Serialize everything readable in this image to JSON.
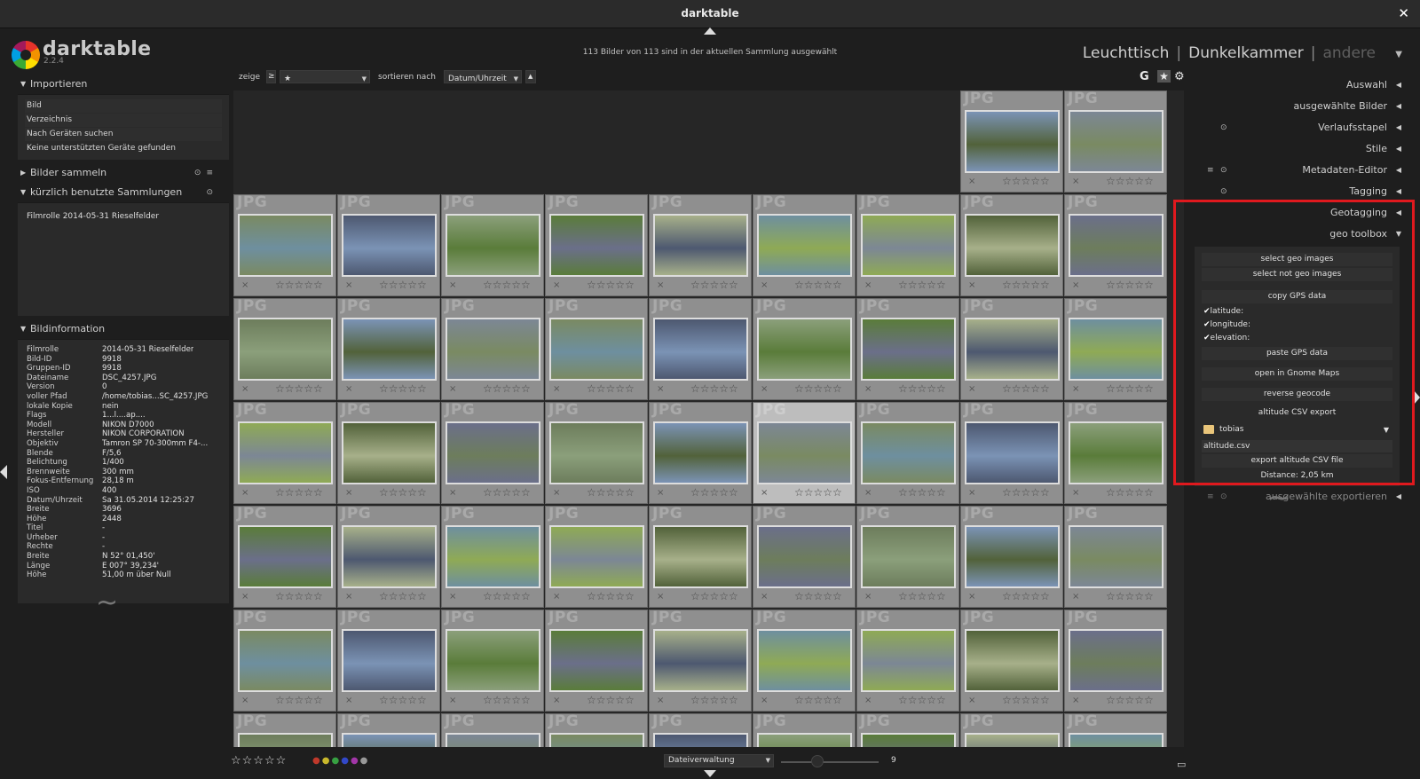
{
  "window": {
    "title": "darktable",
    "close_glyph": "✕"
  },
  "app": {
    "name": "darktable",
    "version": "2.2.4"
  },
  "status": "113 Bilder von 113 sind in der aktuellen Sammlung ausgewählt",
  "views": {
    "lighttable": "Leuchttisch",
    "darkroom": "Dunkelkammer",
    "other": "andere",
    "sep": "|"
  },
  "left": {
    "import": {
      "header": "Importieren",
      "buttons": [
        "Bild",
        "Verzeichnis",
        "Nach Geräten suchen"
      ],
      "note": "Keine unterstützten Geräte gefunden"
    },
    "collect": {
      "header": "Bilder sammeln"
    },
    "recent": {
      "header": "kürzlich benutzte Sammlungen",
      "items": [
        "Filmrolle 2014-05-31 Rieselfelder"
      ]
    },
    "info": {
      "header": "Bildinformation",
      "rows": [
        {
          "k": "Filmrolle",
          "v": "2014-05-31 Rieselfelder"
        },
        {
          "k": "Bild-ID",
          "v": "9918"
        },
        {
          "k": "Gruppen-ID",
          "v": "9918"
        },
        {
          "k": "Dateiname",
          "v": "DSC_4257.JPG"
        },
        {
          "k": "Version",
          "v": "0"
        },
        {
          "k": "voller Pfad",
          "v": "/home/tobias...SC_4257.JPG"
        },
        {
          "k": "lokale Kopie",
          "v": "nein"
        },
        {
          "k": "Flags",
          "v": "1...l....ap...."
        },
        {
          "k": "Modell",
          "v": "NIKON D7000"
        },
        {
          "k": "Hersteller",
          "v": "NIKON CORPORATION"
        },
        {
          "k": "Objektiv",
          "v": "Tamron SP 70-300mm F4-..."
        },
        {
          "k": "Blende",
          "v": "F/5,6"
        },
        {
          "k": "Belichtung",
          "v": "1/400"
        },
        {
          "k": "Brennweite",
          "v": "300 mm"
        },
        {
          "k": "Fokus-Entfernung",
          "v": "28,18 m"
        },
        {
          "k": "ISO",
          "v": "400"
        },
        {
          "k": "Datum/Uhrzeit",
          "v": "Sa 31.05.2014 12:25:27"
        },
        {
          "k": "Breite",
          "v": "3696"
        },
        {
          "k": "Höhe",
          "v": "2448"
        },
        {
          "k": "Titel",
          "v": "-"
        },
        {
          "k": "Urheber",
          "v": "-"
        },
        {
          "k": "Rechte",
          "v": "-"
        },
        {
          "k": "Breite",
          "v": "N 52° 01,450'"
        },
        {
          "k": "Länge",
          "v": "E 007° 39,234'"
        },
        {
          "k": "Höhe",
          "v": "51,00 m über Null"
        }
      ]
    }
  },
  "filter": {
    "show_label": "zeige",
    "comparator": "≥",
    "rating_value": "★",
    "sort_label": "sortieren nach",
    "sort_value": "Datum/Uhrzeit",
    "sort_dir": "▲",
    "grouping": "G",
    "star_icon": "★",
    "gear_icon": "⚙"
  },
  "grid": {
    "ext_label": "JPG",
    "stars": "☆☆☆☆☆",
    "reject": "×",
    "colors": [
      "#52623a",
      "#7a8a62",
      "#6e8f9f",
      "#7b93b5",
      "#5a7c3a",
      "#6b6f8a",
      "#4d5870",
      "#8faa55",
      "#7c8795",
      "#a7b08a",
      "#6d7d5c",
      "#8b9f7b"
    ]
  },
  "right": {
    "modules": [
      "Auswahl",
      "ausgewählte Bilder",
      "Verlaufsstapel",
      "Stile",
      "Metadaten-Editor",
      "Tagging",
      "Geotagging",
      "geo toolbox"
    ],
    "geo": {
      "select_geo": "select geo images",
      "select_not_geo": "select not geo images",
      "copy_gps": "copy GPS data",
      "latitude": "latitude:",
      "longitude": "longitude:",
      "elevation": "elevation:",
      "check": "✔",
      "paste_gps": "paste GPS data",
      "open_maps": "open in Gnome Maps",
      "reverse_geocode": "reverse geocode",
      "altitude_title": "altitude CSV export",
      "folder": "tobias",
      "file": "altitude.csv",
      "export_btn": "export altitude CSV file",
      "distance": "Distance: 2,05 km"
    },
    "export_module": "ausgewählte exportieren"
  },
  "bottom": {
    "stars": "☆☆☆☆☆",
    "layout_combo": "Dateiverwaltung",
    "zoom_value": "9",
    "color_labels": [
      "#c0392b",
      "#c9b82c",
      "#37a042",
      "#3248c8",
      "#a236a8",
      "#999999"
    ]
  }
}
